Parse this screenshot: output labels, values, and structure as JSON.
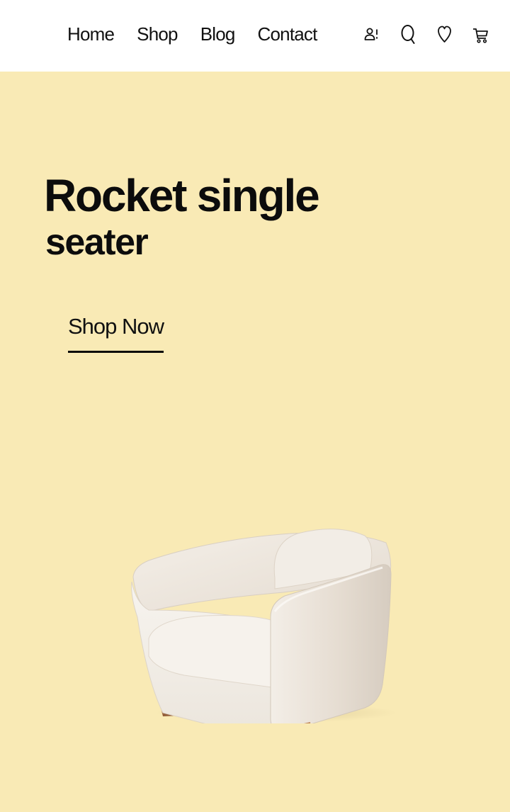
{
  "nav": {
    "items": [
      "Home",
      "Shop",
      "Blog",
      "Contact"
    ],
    "icons": [
      "user-icon",
      "search-icon",
      "heart-icon",
      "cart-icon"
    ]
  },
  "hero": {
    "title_line1": "Rocket single",
    "title_line2": "seater",
    "cta_label": "Shop Now",
    "background": "#F9EAB5",
    "image": "armchair"
  }
}
